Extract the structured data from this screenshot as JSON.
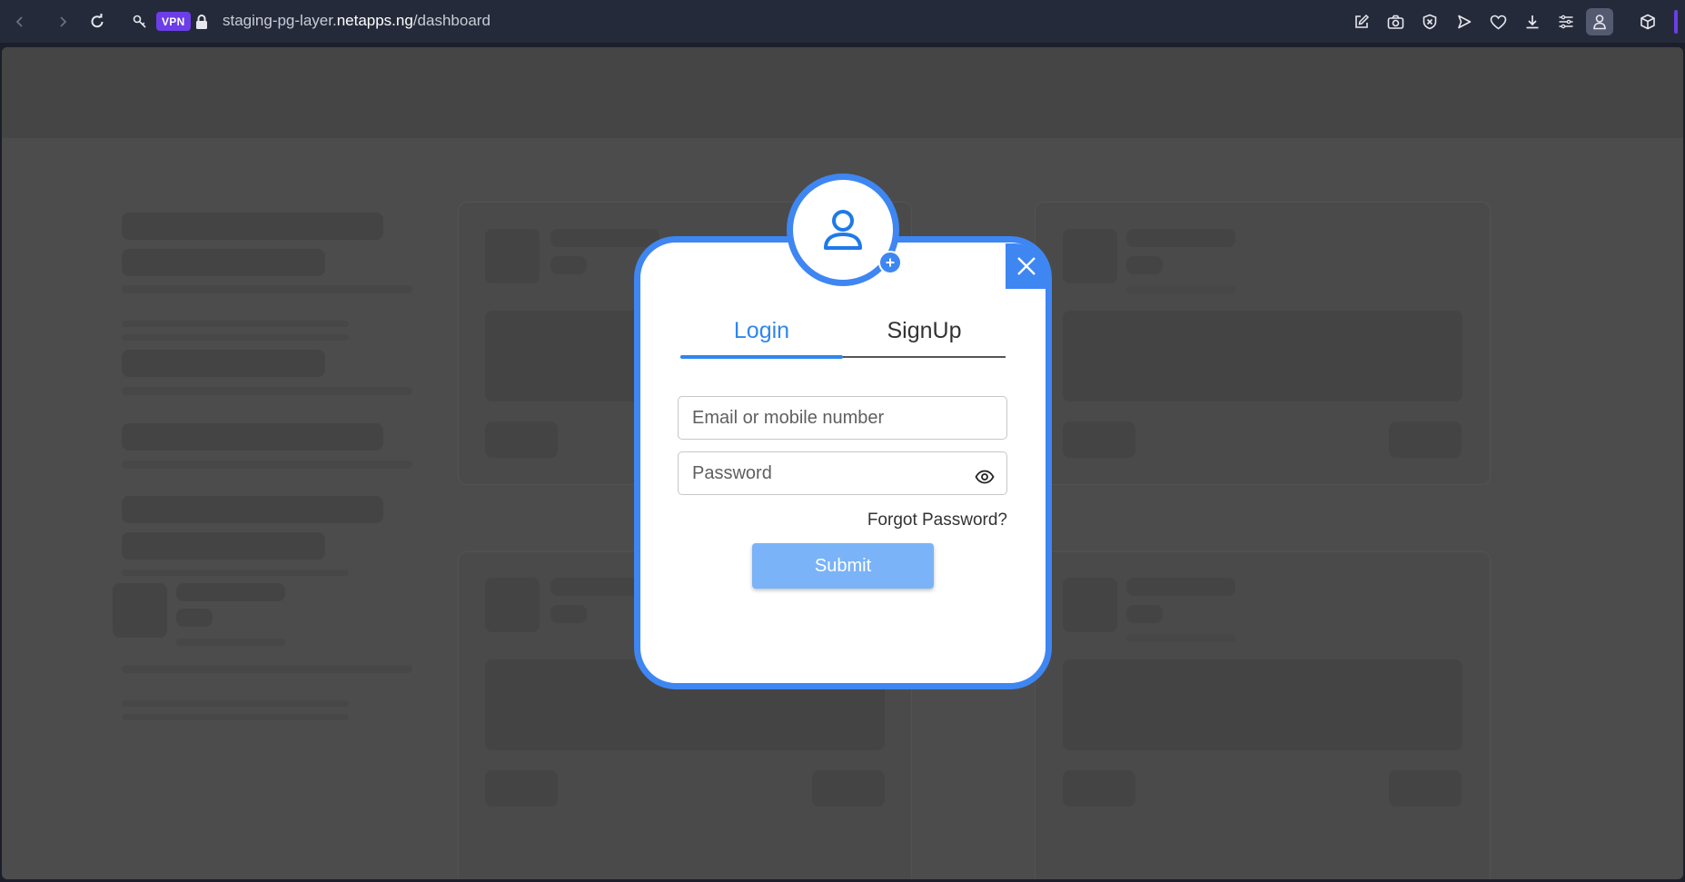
{
  "browser": {
    "vpn_label": "VPN",
    "url_prefix": "staging-pg-layer.",
    "url_host": "netapps.ng",
    "url_path": "/dashboard"
  },
  "modal": {
    "tabs": [
      {
        "label": "Login",
        "active": true
      },
      {
        "label": "SignUp",
        "active": false
      }
    ],
    "email_placeholder": "Email or mobile number",
    "password_placeholder": "Password",
    "forgot_password_label": "Forgot Password?",
    "submit_label": "Submit"
  },
  "colors": {
    "accent": "#3e86f2",
    "submit_bg": "#7ab3f7",
    "tab_active": "#2e86ee",
    "browser_bar": "#252a3a",
    "vpn_badge": "#6b3ee8",
    "overlay": "#4c4c4c"
  },
  "icons": {
    "toolbar": [
      "pen-square-icon",
      "camera-icon",
      "shield-x-icon",
      "send-icon",
      "heart-icon",
      "download-icon",
      "menu-icon",
      "profile-icon",
      "cube-icon"
    ]
  }
}
